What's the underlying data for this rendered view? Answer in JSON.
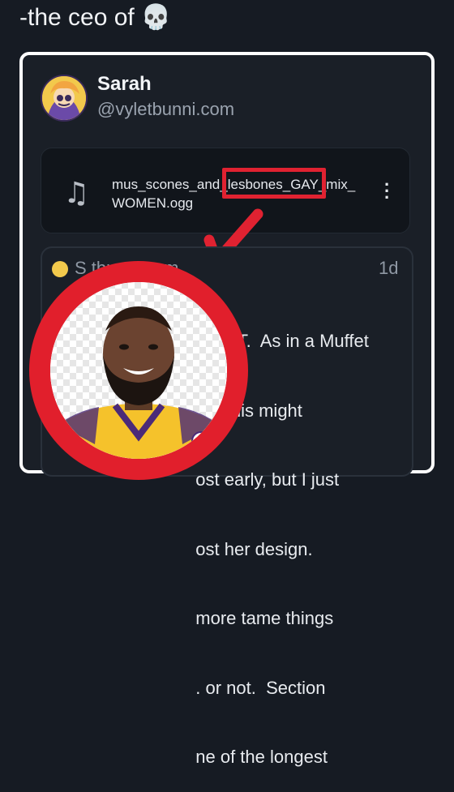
{
  "caption": {
    "text": "-the ceo of",
    "emoji": "💀"
  },
  "post": {
    "author_name": "Sarah",
    "author_handle": "@vyletbunni.com",
    "attachment": {
      "filename": "mus_scones_and_lesbones_GAY_mix_\nWOMEN.ogg",
      "icon": "music-note-icon",
      "menu_icon": "more-vertical-icon"
    },
    "quoted": {
      "header_visible": "S                          tbunni.com",
      "time": "1d",
      "body_lines": [
        "                            UFFET.  As in a Muffet",
        "                             5!  This might",
        "                             ost early, but I just",
        "                             ost her design.",
        "                             more tame things",
        "                             . or not.  Section",
        "                             ne of the longest"
      ]
    }
  },
  "annotations": {
    "highlight_color": "#e02231",
    "overlay_subject": "smiling man in yellow basketball jersey"
  },
  "colors": {
    "background": "#161b23",
    "card": "#1a1f27",
    "accent_red": "#e02231"
  }
}
